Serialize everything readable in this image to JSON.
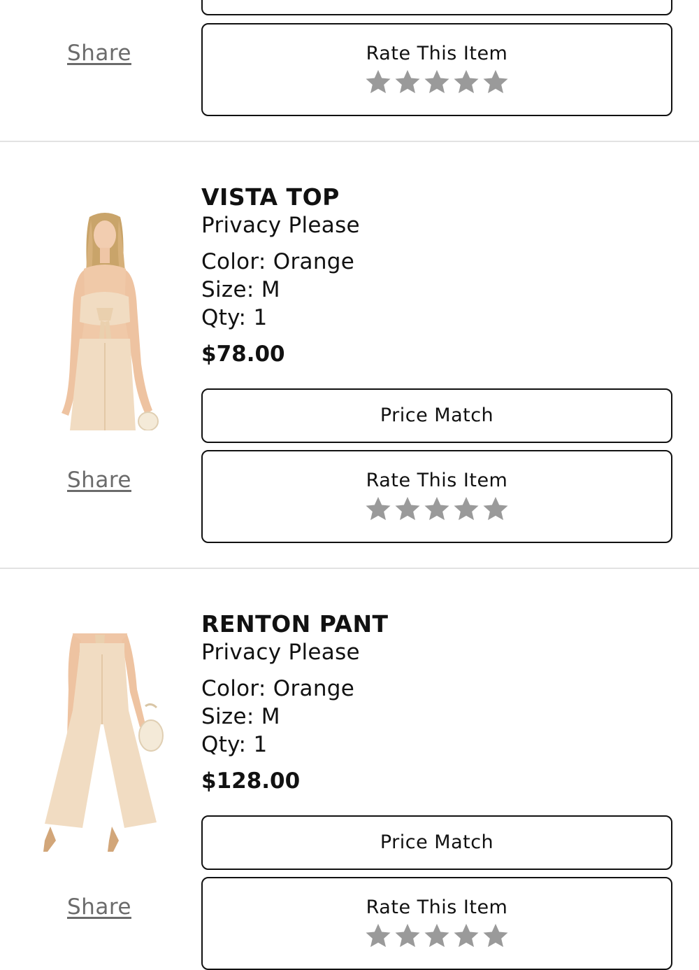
{
  "icons": {
    "star": "star-icon",
    "star_color": "#9a9a9a"
  },
  "colors": {
    "divider": "#e2e2e2",
    "share_link": "#6b6b6b",
    "button_border": "#111111",
    "product_fabric": "#f1dcc2"
  },
  "top_partial_item": {
    "share_label": "Share",
    "rate_label": "Rate This Item",
    "rating": 0
  },
  "items": [
    {
      "name": "VISTA TOP",
      "brand": "Privacy Please",
      "color": "Color: Orange",
      "size": "Size: M",
      "qty": "Qty: 1",
      "price": "$78.00",
      "price_match_label": "Price Match",
      "rate_label": "Rate This Item",
      "share_label": "Share",
      "rating": 0
    },
    {
      "name": "RENTON PANT",
      "brand": "Privacy Please",
      "color": "Color: Orange",
      "size": "Size: M",
      "qty": "Qty: 1",
      "price": "$128.00",
      "price_match_label": "Price Match",
      "rate_label": "Rate This Item",
      "share_label": "Share",
      "rating": 0
    }
  ]
}
